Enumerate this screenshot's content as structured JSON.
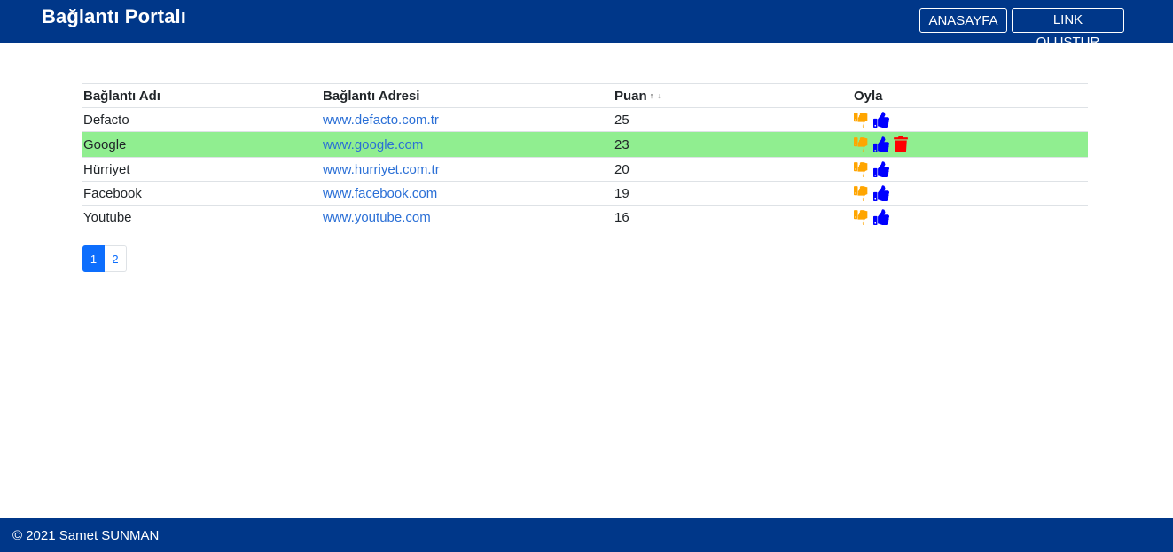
{
  "header": {
    "brand": "Bağlantı Portalı",
    "home_label": "ANASAYFA",
    "create_label": "LINK OLUŞTUR"
  },
  "table": {
    "columns": {
      "name": "Bağlantı Adı",
      "url": "Bağlantı Adresi",
      "score": "Puan",
      "vote": "Oyla"
    },
    "sort_up_icon": "arrow-up-icon",
    "sort_down_icon": "arrow-down-icon",
    "rows": [
      {
        "name": "Defacto",
        "url": "www.defacto.com.tr",
        "score": "25"
      },
      {
        "name": "Google",
        "url": "www.google.com",
        "score": "23"
      },
      {
        "name": "Hürriyet",
        "url": "www.hurriyet.com.tr",
        "score": "20"
      },
      {
        "name": "Facebook",
        "url": "www.facebook.com",
        "score": "19"
      },
      {
        "name": "Youtube",
        "url": "www.youtube.com",
        "score": "16"
      }
    ],
    "highlight_row": 1,
    "highlight_color": "#90ee90",
    "icons": {
      "downvote": "thumbs-down-icon",
      "upvote": "thumbs-up-icon",
      "delete": "trash-icon"
    },
    "colors": {
      "downvote": "#ffa500",
      "upvote": "#0000ff",
      "delete": "#ff0000",
      "link": "#2a6fd6"
    }
  },
  "pagination": {
    "pages": [
      "1",
      "2"
    ],
    "active": "1"
  },
  "footer": {
    "text": "© 2021 Samet SUNMAN"
  },
  "theme": {
    "nav_bg": "#003789"
  }
}
